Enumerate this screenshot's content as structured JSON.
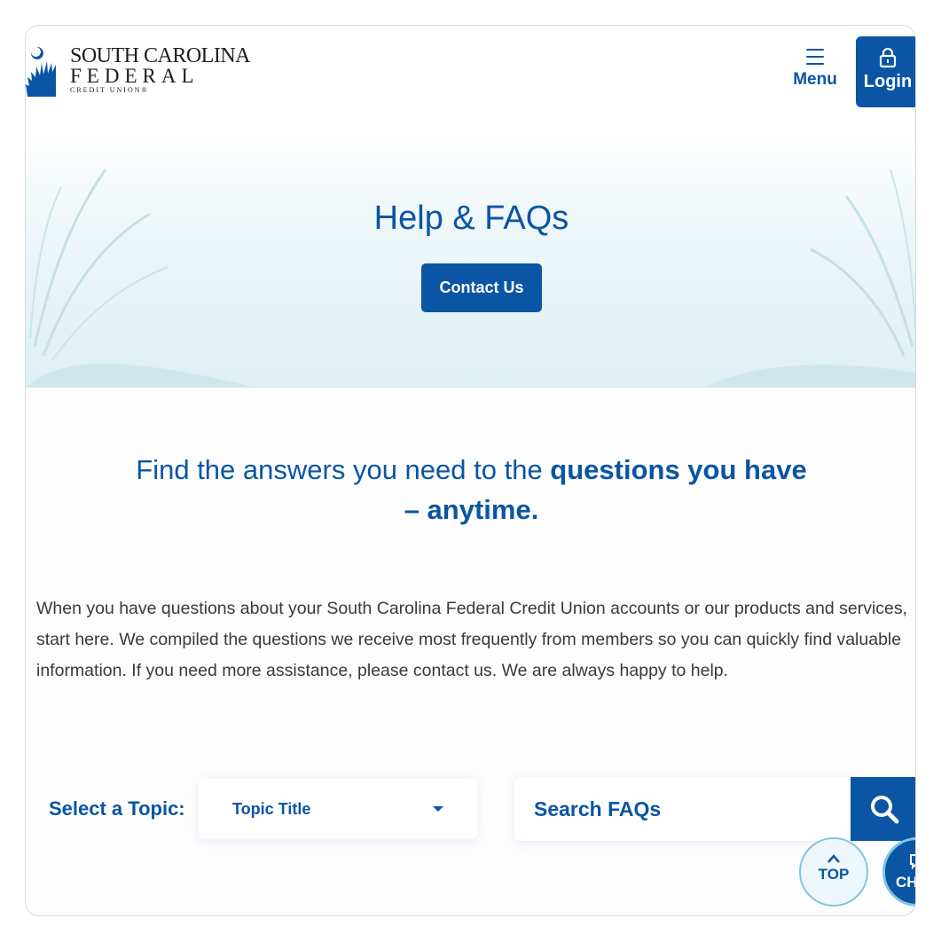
{
  "brand": {
    "line1": "SOUTH CAROLINA",
    "line2": "FEDERAL",
    "line3": "CREDIT UNION®",
    "color": "#0a55a4"
  },
  "header": {
    "menu_label": "Menu",
    "login_label": "Login"
  },
  "hero": {
    "title": "Help & FAQs",
    "contact_label": "Contact Us"
  },
  "content": {
    "headline_plain": "Find the answers you need to the ",
    "headline_bold": "questions you have – anytime.",
    "intro": "When you have questions about your South Carolina Federal Credit Union accounts or our products and services, start here. We compiled the questions we receive most frequently from members so you can quickly find valuable information. If you need more assistance, please contact us. We are always happy to help."
  },
  "filters": {
    "topic_label": "Select a Topic:",
    "topic_value": "Topic Title",
    "search_placeholder": "Search FAQs"
  },
  "floating": {
    "top_label": "TOP",
    "chat_label": "CH"
  },
  "icons": {
    "menu": "hamburger-icon",
    "login": "lock-icon",
    "search": "magnifier-icon",
    "top": "chevron-up-icon",
    "chat": "chat-bubble-icon"
  }
}
